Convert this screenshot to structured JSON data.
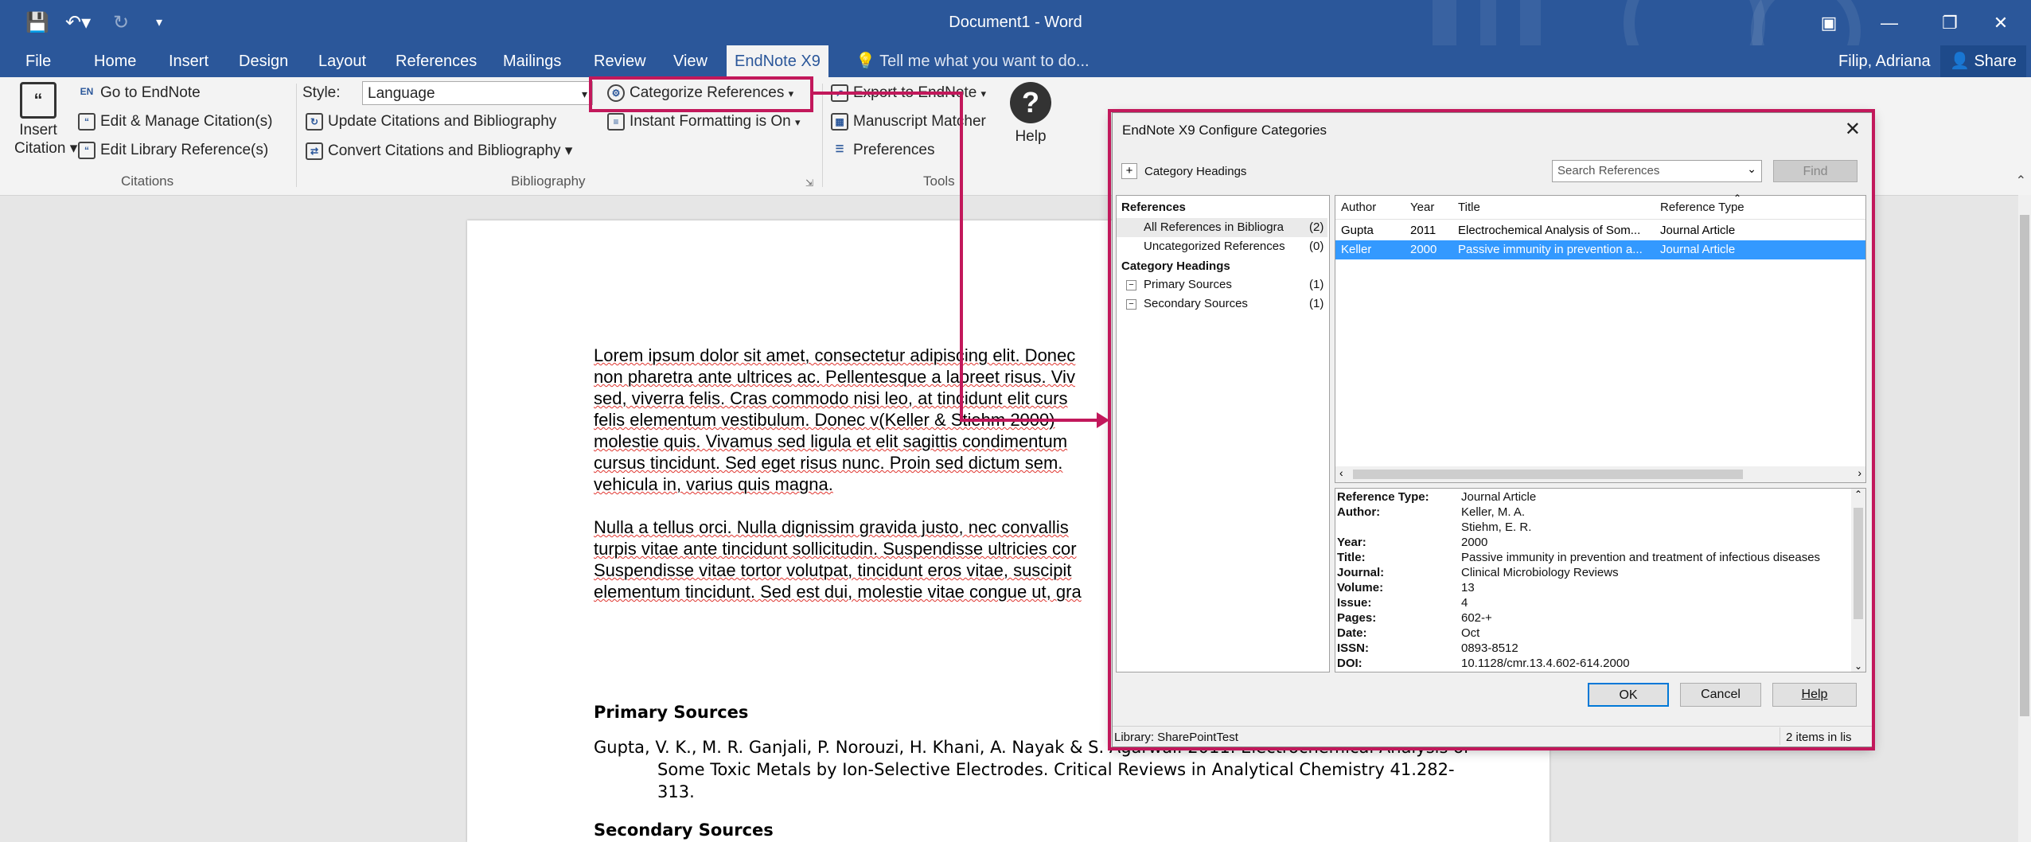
{
  "colors": {
    "word_blue": "#2b579a",
    "highlight": "#c2185b",
    "selection": "#3399ff"
  },
  "titlebar": {
    "title": "Document1 - Word",
    "save_icon": "save-icon",
    "undo_icon": "undo-icon",
    "redo_icon": "redo-icon"
  },
  "tabs": [
    {
      "label": "File"
    },
    {
      "label": "Home"
    },
    {
      "label": "Insert"
    },
    {
      "label": "Design"
    },
    {
      "label": "Layout"
    },
    {
      "label": "References"
    },
    {
      "label": "Mailings"
    },
    {
      "label": "Review"
    },
    {
      "label": "View"
    },
    {
      "label": "EndNote X9",
      "active": true
    }
  ],
  "tell_me": "Tell me what you want to do...",
  "user": "Filip, Adriana",
  "share": "Share",
  "ribbon": {
    "insert_citation": [
      "Insert",
      "Citation"
    ],
    "go_to_endnote": "Go to EndNote",
    "edit_manage": "Edit & Manage Citation(s)",
    "edit_library": "Edit Library Reference(s)",
    "citations_group": "Citations",
    "style_label": "Style:",
    "style_value": "Language",
    "update_citations": "Update Citations and Bibliography",
    "convert_citations": "Convert Citations and Bibliography",
    "categorize": "Categorize References",
    "instant_formatting": "Instant Formatting is On",
    "bibliography_group": "Bibliography",
    "export": "Export to EndNote",
    "manuscript": "Manuscript Matcher",
    "preferences": "Preferences",
    "help": "Help",
    "tools_group": "Tools"
  },
  "document": {
    "para1_lines": [
      "Lorem ipsum dolor sit amet, consectetur adipiscing elit. Donec",
      "non pharetra ante ultrices ac. Pellentesque a laoreet risus. Viv",
      "sed, viverra felis. Cras commodo nisi leo, at tincidunt elit curs",
      "felis elementum vestibulum. Donec v(Keller & Stiehm 2000)",
      "molestie quis. Vivamus sed ligula et elit sagittis condimentum",
      "cursus tincidunt. Sed eget risus nunc. Proin sed dictum sem.",
      "vehicula in, varius quis magna."
    ],
    "para2_lines": [
      "Nulla a tellus orci. Nulla dignissim gravida justo, nec convallis",
      "turpis vitae ante tincidunt sollicitudin. Suspendisse ultricies cor",
      "Suspendisse vitae tortor volutpat, tincidunt eros vitae, suscipit",
      "elementum tincidunt. Sed est dui, molestie vitae congue ut, gra"
    ],
    "primary_heading": "Primary Sources",
    "primary_entry": [
      "Gupta, V. K., M. R. Ganjali, P. Norouzi, H. Khani, A. Nayak & S. Agarwal. 2011. Electrochemical Analysis of",
      "Some Toxic Metals by Ion-Selective Electrodes. Critical Reviews in Analytical Chemistry 41.282-",
      "313."
    ],
    "secondary_heading": "Secondary Sources"
  },
  "dialog": {
    "title": "EndNote X9 Configure Categories",
    "add_category": "Category Headings",
    "search_placeholder": "Search References",
    "find": "Find",
    "tree": {
      "references_heading": "References",
      "all_refs": "All References in Bibliogra",
      "all_count": "(2)",
      "uncategorized": "Uncategorized References",
      "uncat_count": "(0)",
      "category_heading": "Category Headings",
      "primary": "Primary Sources",
      "primary_count": "(1)",
      "secondary": "Secondary Sources",
      "secondary_count": "(1)"
    },
    "columns": [
      "Author",
      "Year",
      "Title",
      "Reference Type"
    ],
    "rows": [
      {
        "author": "Gupta",
        "year": "2011",
        "title": "Electrochemical Analysis of Som...",
        "type": "Journal Article"
      },
      {
        "author": "Keller",
        "year": "2000",
        "title": "Passive immunity in prevention a...",
        "type": "Journal Article",
        "selected": true
      }
    ],
    "details": [
      {
        "label": "Reference Type:",
        "value": "Journal Article"
      },
      {
        "label": "Author:",
        "value": "Keller, M. A."
      },
      {
        "label": "",
        "value": "Stiehm, E. R."
      },
      {
        "label": "Year:",
        "value": "2000"
      },
      {
        "label": "Title:",
        "value": "Passive immunity in prevention and treatment of infectious diseases"
      },
      {
        "label": "Journal:",
        "value": "Clinical Microbiology Reviews"
      },
      {
        "label": "Volume:",
        "value": "13"
      },
      {
        "label": "Issue:",
        "value": "4"
      },
      {
        "label": "Pages:",
        "value": "602-+"
      },
      {
        "label": "Date:",
        "value": "Oct"
      },
      {
        "label": "ISSN:",
        "value": "0893-8512"
      },
      {
        "label": "DOI:",
        "value": "10.1128/cmr.13.4.602-614.2000"
      }
    ],
    "ok": "OK",
    "cancel": "Cancel",
    "help": "Help",
    "status_library": "Library: SharePointTest",
    "status_count": "2 items in lis"
  }
}
